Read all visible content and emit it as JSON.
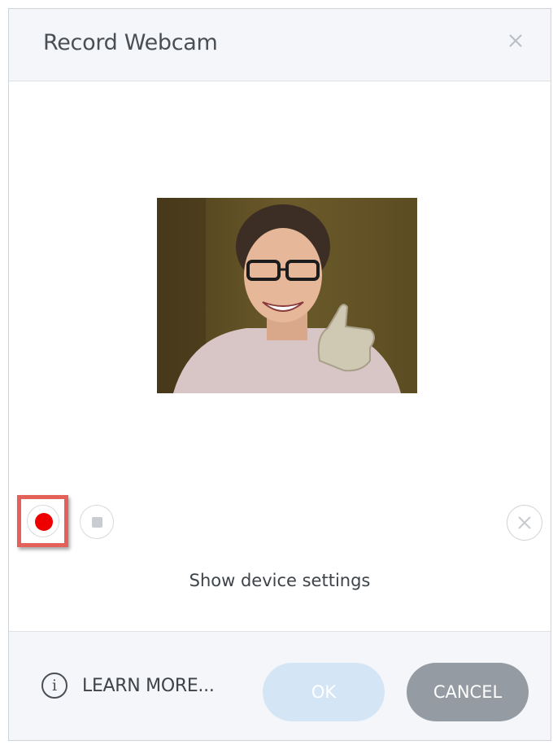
{
  "dialog": {
    "title": "Record Webcam",
    "close_icon": "close-icon"
  },
  "video": {
    "description_icon": "webcam-preview"
  },
  "controls": {
    "record_icon": "record-icon",
    "stop_icon": "stop-icon",
    "discard_icon": "discard-icon",
    "record_color": "#ee0000",
    "highlight_color": "#e36159"
  },
  "device_settings_label": "Show device settings",
  "footer": {
    "info_icon": "info-icon",
    "learn_more_label": "LEARN MORE...",
    "ok_label": "OK",
    "cancel_label": "CANCEL"
  },
  "colors": {
    "ok_button": "#d4e6f6",
    "cancel_button": "#949ba3"
  }
}
